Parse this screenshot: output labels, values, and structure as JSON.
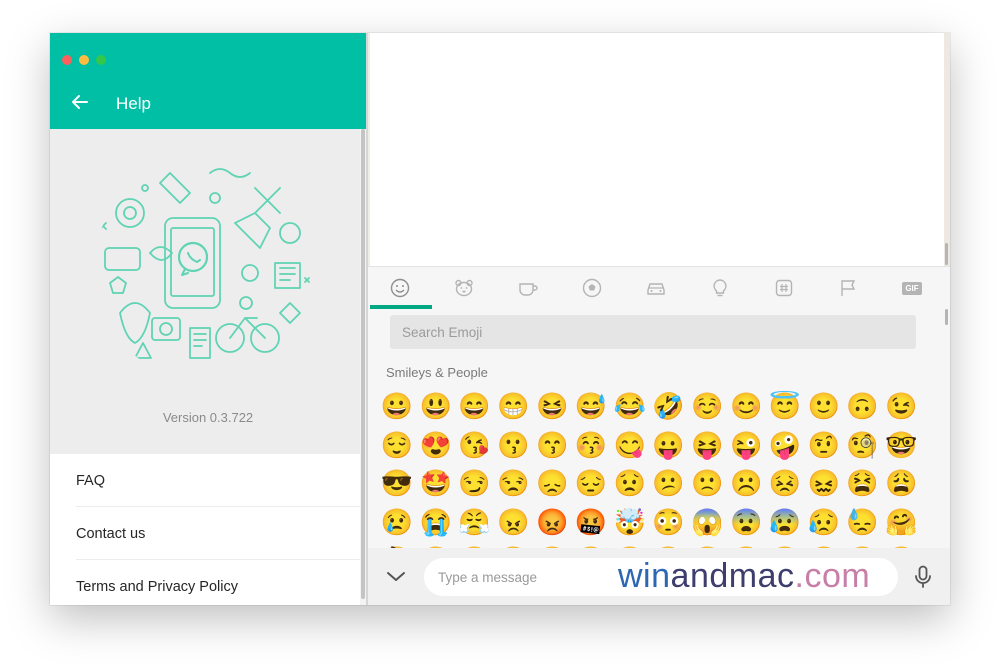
{
  "window": {
    "traffic_lights": [
      "close",
      "minimize",
      "zoom"
    ]
  },
  "left_panel": {
    "header_title": "Help",
    "back_icon": "arrow-left-icon",
    "header_color": "#00bfa5",
    "illustration": "whatsapp-doodle-illustration",
    "version": "Version 0.3.722",
    "menu_items": [
      {
        "label": "FAQ"
      },
      {
        "label": "Contact us"
      },
      {
        "label": "Terms and Privacy Policy"
      }
    ]
  },
  "emoji_panel": {
    "tabs": [
      {
        "icon": "smiley-icon",
        "active": true
      },
      {
        "icon": "animal-icon",
        "active": false
      },
      {
        "icon": "coffee-cup-icon",
        "active": false
      },
      {
        "icon": "soccer-ball-icon",
        "active": false
      },
      {
        "icon": "car-icon",
        "active": false
      },
      {
        "icon": "lightbulb-icon",
        "active": false
      },
      {
        "icon": "symbols-icon",
        "active": false
      },
      {
        "icon": "flag-icon",
        "active": false
      },
      {
        "icon": "gif-icon",
        "label": "GIF",
        "active": false
      }
    ],
    "accent_color": "#00a884",
    "search_placeholder": "Search Emoji",
    "category_label": "Smileys & People",
    "rows": [
      [
        "😀",
        "😃",
        "😄",
        "😁",
        "😆",
        "😅",
        "😂",
        "🤣",
        "☺️",
        "😊",
        "😇",
        "🙂",
        "🙃",
        "😉"
      ],
      [
        "😌",
        "😍",
        "😘",
        "😗",
        "😙",
        "😚",
        "😋",
        "😛",
        "😝",
        "😜",
        "🤪",
        "🤨",
        "🧐",
        "🤓"
      ],
      [
        "😎",
        "🤩",
        "😏",
        "😒",
        "😞",
        "😔",
        "😟",
        "😕",
        "🙁",
        "☹️",
        "😣",
        "😖",
        "😫",
        "😩"
      ],
      [
        "😢",
        "😭",
        "😤",
        "😠",
        "😡",
        "🤬",
        "🤯",
        "😳",
        "😱",
        "😨",
        "😰",
        "😥",
        "😓",
        "🤗"
      ],
      [
        "🤔",
        "🤭",
        "🤫",
        "🤥",
        "😶",
        "😐",
        "😑",
        "😬",
        "🙄",
        "😯",
        "😦",
        "😧",
        "😮",
        "😲"
      ]
    ]
  },
  "compose": {
    "placeholder": "Type a message",
    "expand_icon": "chevron-down-icon",
    "mic_icon": "microphone-icon"
  },
  "watermark": {
    "part1": "win",
    "part2": "andmac",
    "part3": ".com"
  }
}
